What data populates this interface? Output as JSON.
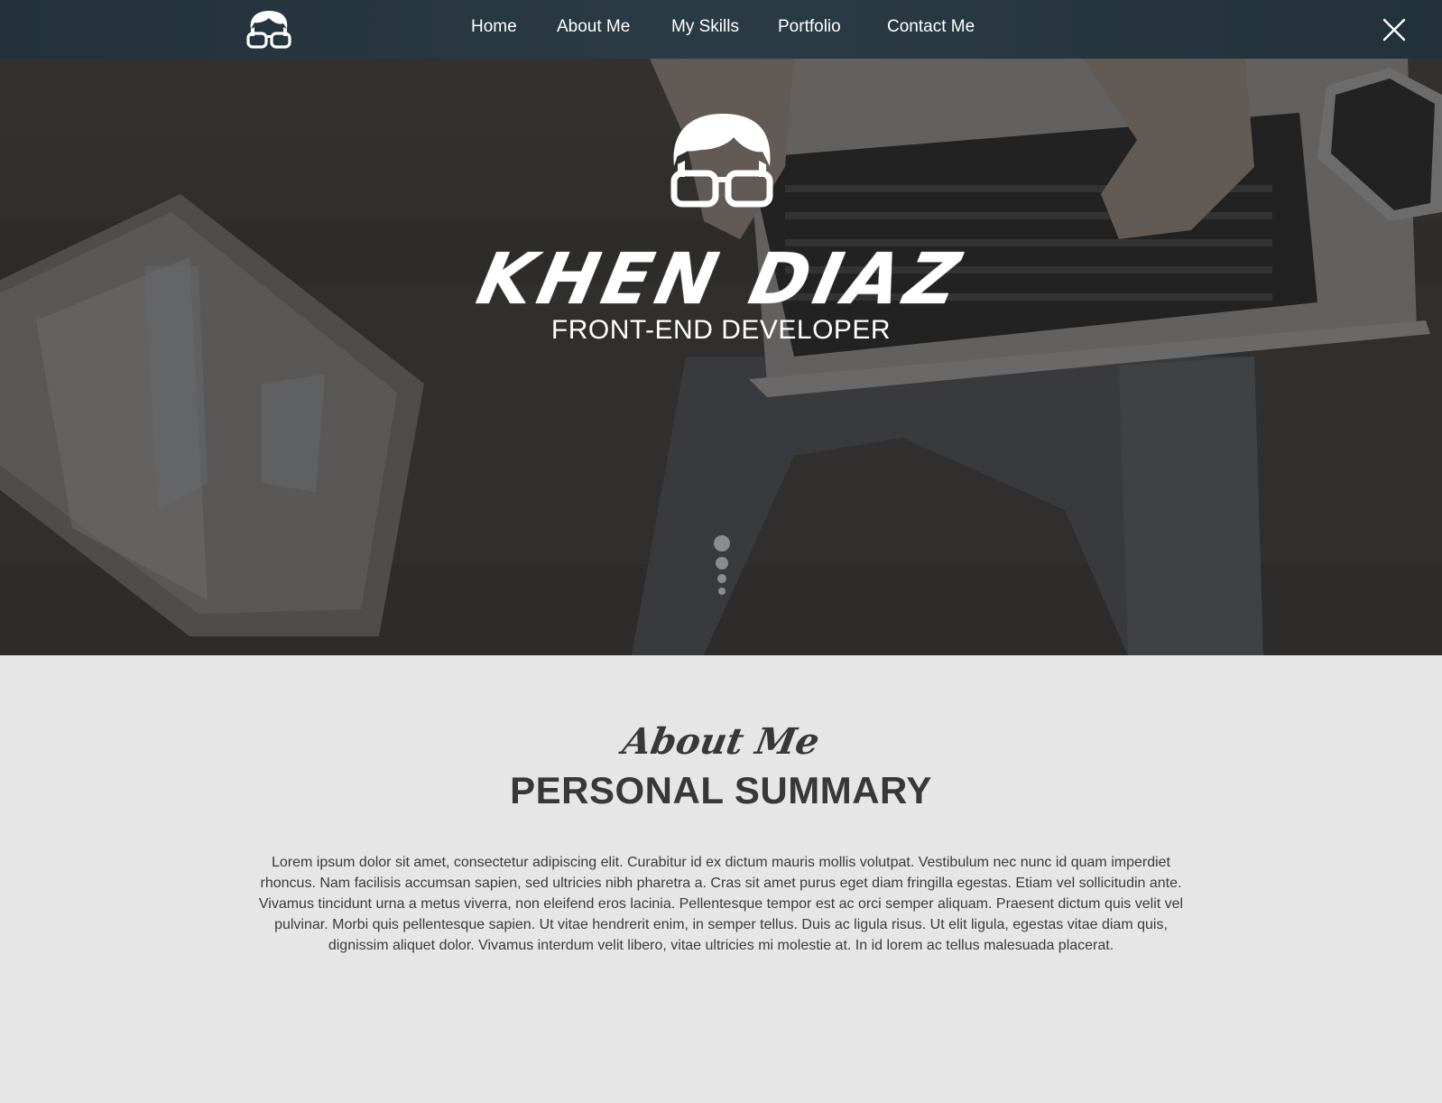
{
  "nav": {
    "logo_icon": "nerd-glasses-logo-icon",
    "items": [
      {
        "label": "Home"
      },
      {
        "label": "About Me"
      },
      {
        "label": "My Skills"
      },
      {
        "label": "Portfolio"
      },
      {
        "label": "Contact Me"
      }
    ],
    "close_icon": "close-icon"
  },
  "hero": {
    "name": "KHEN DIAZ",
    "role": "FRONT-END DEVELOPER",
    "mascot_icon": "nerd-glasses-mascot-icon",
    "scroll_indicator_icon": "scroll-down-dots-icon"
  },
  "about": {
    "script_title": "About Me",
    "title": "PERSONAL SUMMARY",
    "text": "Lorem ipsum dolor sit amet, consectetur adipiscing elit. Curabitur id ex dictum mauris mollis volutpat. Vestibulum nec nunc id quam imperdiet rhoncus. Nam facilisis accumsan sapien, sed ultricies nibh pharetra a. Cras sit amet purus eget diam fringilla egestas. Etiam vel sollicitudin ante. Vivamus tincidunt urna a metus viverra, non eleifend eros lacinia. Pellentesque tempor est ac orci semper aliquam. Praesent dictum quis velit vel pulvinar. Morbi quis pellentesque sapien. Ut vitae hendrerit enim, in semper tellus. Duis ac ligula risus. Ut elit ligula, egestas vitae diam quis, dignissim aliquet dolor. Vivamus interdum velit libero, vitae ultricies mi molestie at. In id lorem ac tellus malesuada placerat."
  },
  "colors": {
    "nav_bg": "#2b3b45",
    "about_bg": "#e6e6e6",
    "heading_text": "#383838",
    "hero_text": "#ffffff"
  }
}
